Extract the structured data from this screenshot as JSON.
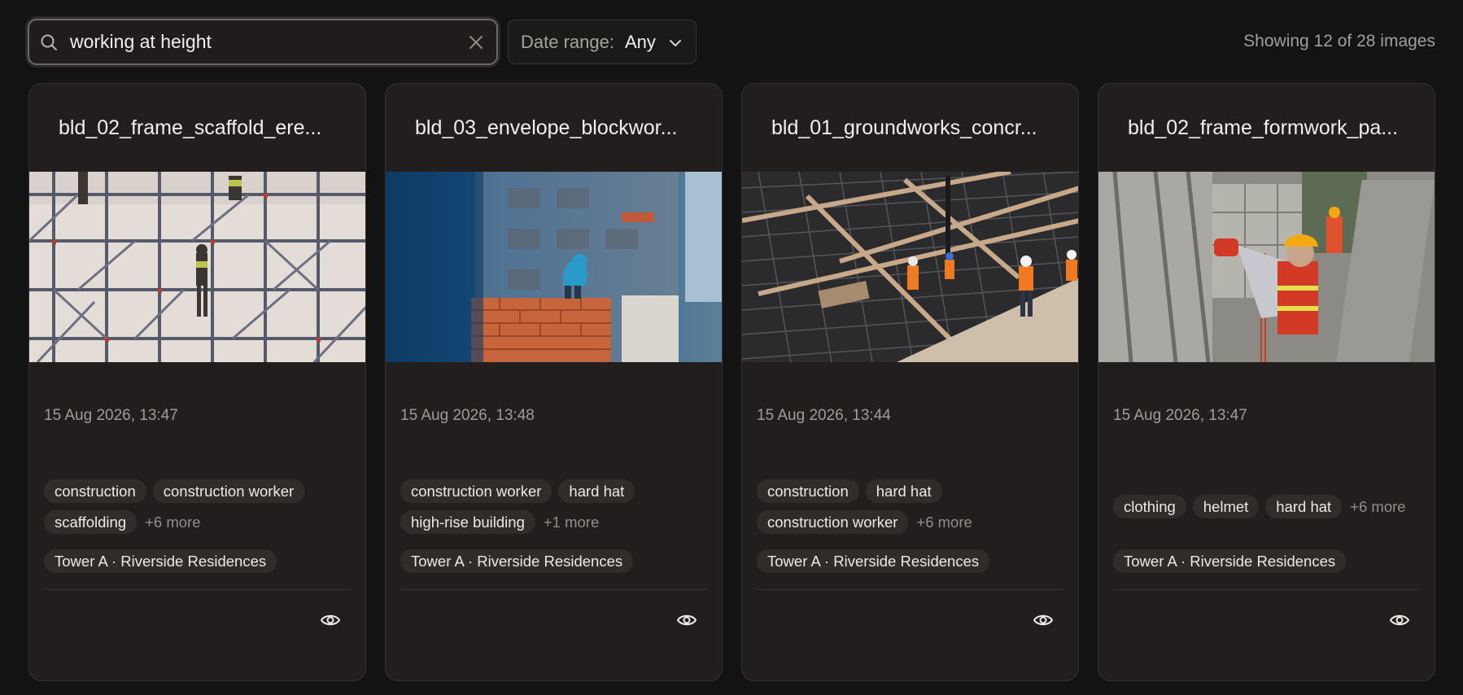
{
  "search": {
    "query": "working at height"
  },
  "date_range": {
    "label": "Date range:",
    "value": "Any"
  },
  "status": {
    "showing": "Showing 12 of 28 images"
  },
  "cards": [
    {
      "title": "bld_02_frame_scaffold_ere...",
      "date": "15 Aug 2026, 13:47",
      "tags": [
        "construction",
        "construction worker",
        "scaffolding"
      ],
      "more": "+6 more",
      "location": "Tower A · Riverside Residences"
    },
    {
      "title": "bld_03_envelope_blockwor...",
      "date": "15 Aug 2026, 13:48",
      "tags": [
        "construction worker",
        "hard hat",
        "high-rise building"
      ],
      "more": "+1 more",
      "location": "Tower A · Riverside Residences"
    },
    {
      "title": "bld_01_groundworks_concr...",
      "date": "15 Aug 2026, 13:44",
      "tags": [
        "construction",
        "hard hat",
        "construction worker"
      ],
      "more": "+6 more",
      "location": "Tower A · Riverside Residences"
    },
    {
      "title": "bld_02_frame_formwork_pa...",
      "date": "15 Aug 2026, 13:47",
      "tags": [
        "clothing",
        "helmet",
        "hard hat"
      ],
      "more": "+6 more",
      "location": "Tower A · Riverside Residences"
    }
  ]
}
